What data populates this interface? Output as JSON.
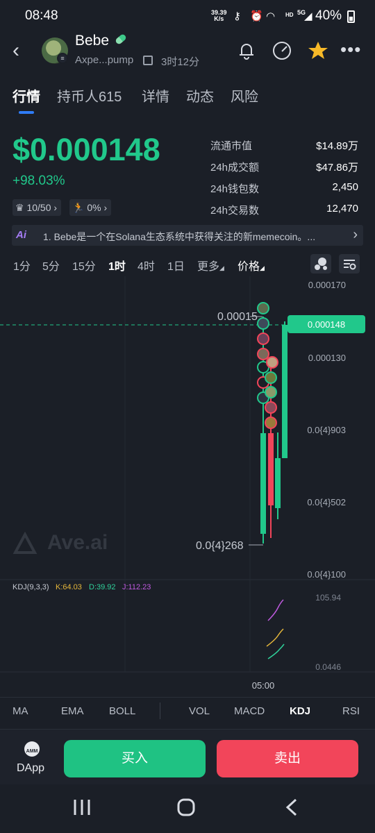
{
  "status_bar": {
    "time": "08:48",
    "net_speed_value": "39.39",
    "net_speed_unit": "K/s",
    "hd_label": "HD",
    "net_type": "5G",
    "battery_pct": "40%"
  },
  "header": {
    "token_name": "Bebe",
    "address": "Axpe...pump",
    "age": "3时12分"
  },
  "tabs": [
    {
      "label": "行情",
      "active": true
    },
    {
      "label": "持币人615",
      "active": false
    },
    {
      "label": "详情",
      "active": false
    },
    {
      "label": "动态",
      "active": false
    },
    {
      "label": "风险",
      "active": false
    }
  ],
  "price": {
    "value": "$0.000148",
    "change": "+98.03%",
    "chip1": "10/50",
    "chip2": "0%"
  },
  "stats": [
    {
      "label": "流通市值",
      "value": "$14.89万"
    },
    {
      "label": "24h成交额",
      "value": "$47.86万"
    },
    {
      "label": "24h钱包数",
      "value": "2,450"
    },
    {
      "label": "24h交易数",
      "value": "12,470"
    }
  ],
  "ai_banner": {
    "logo": "Ai",
    "text": "1. Bebe是一个在Solana生态系统中获得关注的新memecoin。..."
  },
  "timeframes": [
    {
      "label": "1分",
      "active": false
    },
    {
      "label": "5分",
      "active": false
    },
    {
      "label": "15分",
      "active": false
    },
    {
      "label": "1时",
      "active": true
    },
    {
      "label": "4时",
      "active": false
    },
    {
      "label": "1日",
      "active": false
    },
    {
      "label": "更多",
      "active": false
    },
    {
      "label": "价格",
      "active": false
    }
  ],
  "chart": {
    "y_labels": [
      "0.000170",
      "0.000130",
      "0.0{4}903",
      "0.0{4}502",
      "0.0{4}100"
    ],
    "current_price_label": "0.000148",
    "high_label": "0.00015",
    "low_label": "0.0{4}268",
    "watermark": "Ave.ai",
    "kdj_params": "KDJ(9,3,3)",
    "kdj_k": "K:64.03",
    "kdj_d": "D:39.92",
    "kdj_j": "J:112.23",
    "kdj_top": "105.94",
    "kdj_bottom": "0.0446",
    "time_label": "05:00",
    "colors": {
      "up": "#21c88b",
      "down": "#f2455a",
      "k": "#e5b73b",
      "d": "#2fd19a",
      "j": "#c05ae0"
    }
  },
  "indicators": [
    {
      "label": "MA",
      "active": false
    },
    {
      "label": "EMA",
      "active": false
    },
    {
      "label": "BOLL",
      "active": false
    },
    {
      "label": "VOL",
      "active": false
    },
    {
      "label": "MACD",
      "active": false
    },
    {
      "label": "KDJ",
      "active": true
    },
    {
      "label": "RSI",
      "active": false
    }
  ],
  "actions": {
    "amm_badge": "AMM",
    "dapp": "DApp",
    "buy": "买入",
    "sell": "卖出"
  }
}
